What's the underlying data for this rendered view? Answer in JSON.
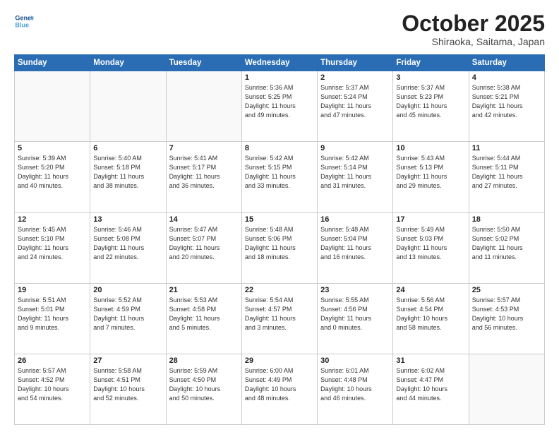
{
  "header": {
    "logo_line1": "General",
    "logo_line2": "Blue",
    "title": "October 2025",
    "location": "Shiraoka, Saitama, Japan"
  },
  "weekdays": [
    "Sunday",
    "Monday",
    "Tuesday",
    "Wednesday",
    "Thursday",
    "Friday",
    "Saturday"
  ],
  "weeks": [
    [
      {
        "day": "",
        "info": ""
      },
      {
        "day": "",
        "info": ""
      },
      {
        "day": "",
        "info": ""
      },
      {
        "day": "1",
        "info": "Sunrise: 5:36 AM\nSunset: 5:25 PM\nDaylight: 11 hours\nand 49 minutes."
      },
      {
        "day": "2",
        "info": "Sunrise: 5:37 AM\nSunset: 5:24 PM\nDaylight: 11 hours\nand 47 minutes."
      },
      {
        "day": "3",
        "info": "Sunrise: 5:37 AM\nSunset: 5:23 PM\nDaylight: 11 hours\nand 45 minutes."
      },
      {
        "day": "4",
        "info": "Sunrise: 5:38 AM\nSunset: 5:21 PM\nDaylight: 11 hours\nand 42 minutes."
      }
    ],
    [
      {
        "day": "5",
        "info": "Sunrise: 5:39 AM\nSunset: 5:20 PM\nDaylight: 11 hours\nand 40 minutes."
      },
      {
        "day": "6",
        "info": "Sunrise: 5:40 AM\nSunset: 5:18 PM\nDaylight: 11 hours\nand 38 minutes."
      },
      {
        "day": "7",
        "info": "Sunrise: 5:41 AM\nSunset: 5:17 PM\nDaylight: 11 hours\nand 36 minutes."
      },
      {
        "day": "8",
        "info": "Sunrise: 5:42 AM\nSunset: 5:15 PM\nDaylight: 11 hours\nand 33 minutes."
      },
      {
        "day": "9",
        "info": "Sunrise: 5:42 AM\nSunset: 5:14 PM\nDaylight: 11 hours\nand 31 minutes."
      },
      {
        "day": "10",
        "info": "Sunrise: 5:43 AM\nSunset: 5:13 PM\nDaylight: 11 hours\nand 29 minutes."
      },
      {
        "day": "11",
        "info": "Sunrise: 5:44 AM\nSunset: 5:11 PM\nDaylight: 11 hours\nand 27 minutes."
      }
    ],
    [
      {
        "day": "12",
        "info": "Sunrise: 5:45 AM\nSunset: 5:10 PM\nDaylight: 11 hours\nand 24 minutes."
      },
      {
        "day": "13",
        "info": "Sunrise: 5:46 AM\nSunset: 5:08 PM\nDaylight: 11 hours\nand 22 minutes."
      },
      {
        "day": "14",
        "info": "Sunrise: 5:47 AM\nSunset: 5:07 PM\nDaylight: 11 hours\nand 20 minutes."
      },
      {
        "day": "15",
        "info": "Sunrise: 5:48 AM\nSunset: 5:06 PM\nDaylight: 11 hours\nand 18 minutes."
      },
      {
        "day": "16",
        "info": "Sunrise: 5:48 AM\nSunset: 5:04 PM\nDaylight: 11 hours\nand 16 minutes."
      },
      {
        "day": "17",
        "info": "Sunrise: 5:49 AM\nSunset: 5:03 PM\nDaylight: 11 hours\nand 13 minutes."
      },
      {
        "day": "18",
        "info": "Sunrise: 5:50 AM\nSunset: 5:02 PM\nDaylight: 11 hours\nand 11 minutes."
      }
    ],
    [
      {
        "day": "19",
        "info": "Sunrise: 5:51 AM\nSunset: 5:01 PM\nDaylight: 11 hours\nand 9 minutes."
      },
      {
        "day": "20",
        "info": "Sunrise: 5:52 AM\nSunset: 4:59 PM\nDaylight: 11 hours\nand 7 minutes."
      },
      {
        "day": "21",
        "info": "Sunrise: 5:53 AM\nSunset: 4:58 PM\nDaylight: 11 hours\nand 5 minutes."
      },
      {
        "day": "22",
        "info": "Sunrise: 5:54 AM\nSunset: 4:57 PM\nDaylight: 11 hours\nand 3 minutes."
      },
      {
        "day": "23",
        "info": "Sunrise: 5:55 AM\nSunset: 4:56 PM\nDaylight: 11 hours\nand 0 minutes."
      },
      {
        "day": "24",
        "info": "Sunrise: 5:56 AM\nSunset: 4:54 PM\nDaylight: 10 hours\nand 58 minutes."
      },
      {
        "day": "25",
        "info": "Sunrise: 5:57 AM\nSunset: 4:53 PM\nDaylight: 10 hours\nand 56 minutes."
      }
    ],
    [
      {
        "day": "26",
        "info": "Sunrise: 5:57 AM\nSunset: 4:52 PM\nDaylight: 10 hours\nand 54 minutes."
      },
      {
        "day": "27",
        "info": "Sunrise: 5:58 AM\nSunset: 4:51 PM\nDaylight: 10 hours\nand 52 minutes."
      },
      {
        "day": "28",
        "info": "Sunrise: 5:59 AM\nSunset: 4:50 PM\nDaylight: 10 hours\nand 50 minutes."
      },
      {
        "day": "29",
        "info": "Sunrise: 6:00 AM\nSunset: 4:49 PM\nDaylight: 10 hours\nand 48 minutes."
      },
      {
        "day": "30",
        "info": "Sunrise: 6:01 AM\nSunset: 4:48 PM\nDaylight: 10 hours\nand 46 minutes."
      },
      {
        "day": "31",
        "info": "Sunrise: 6:02 AM\nSunset: 4:47 PM\nDaylight: 10 hours\nand 44 minutes."
      },
      {
        "day": "",
        "info": ""
      }
    ]
  ]
}
